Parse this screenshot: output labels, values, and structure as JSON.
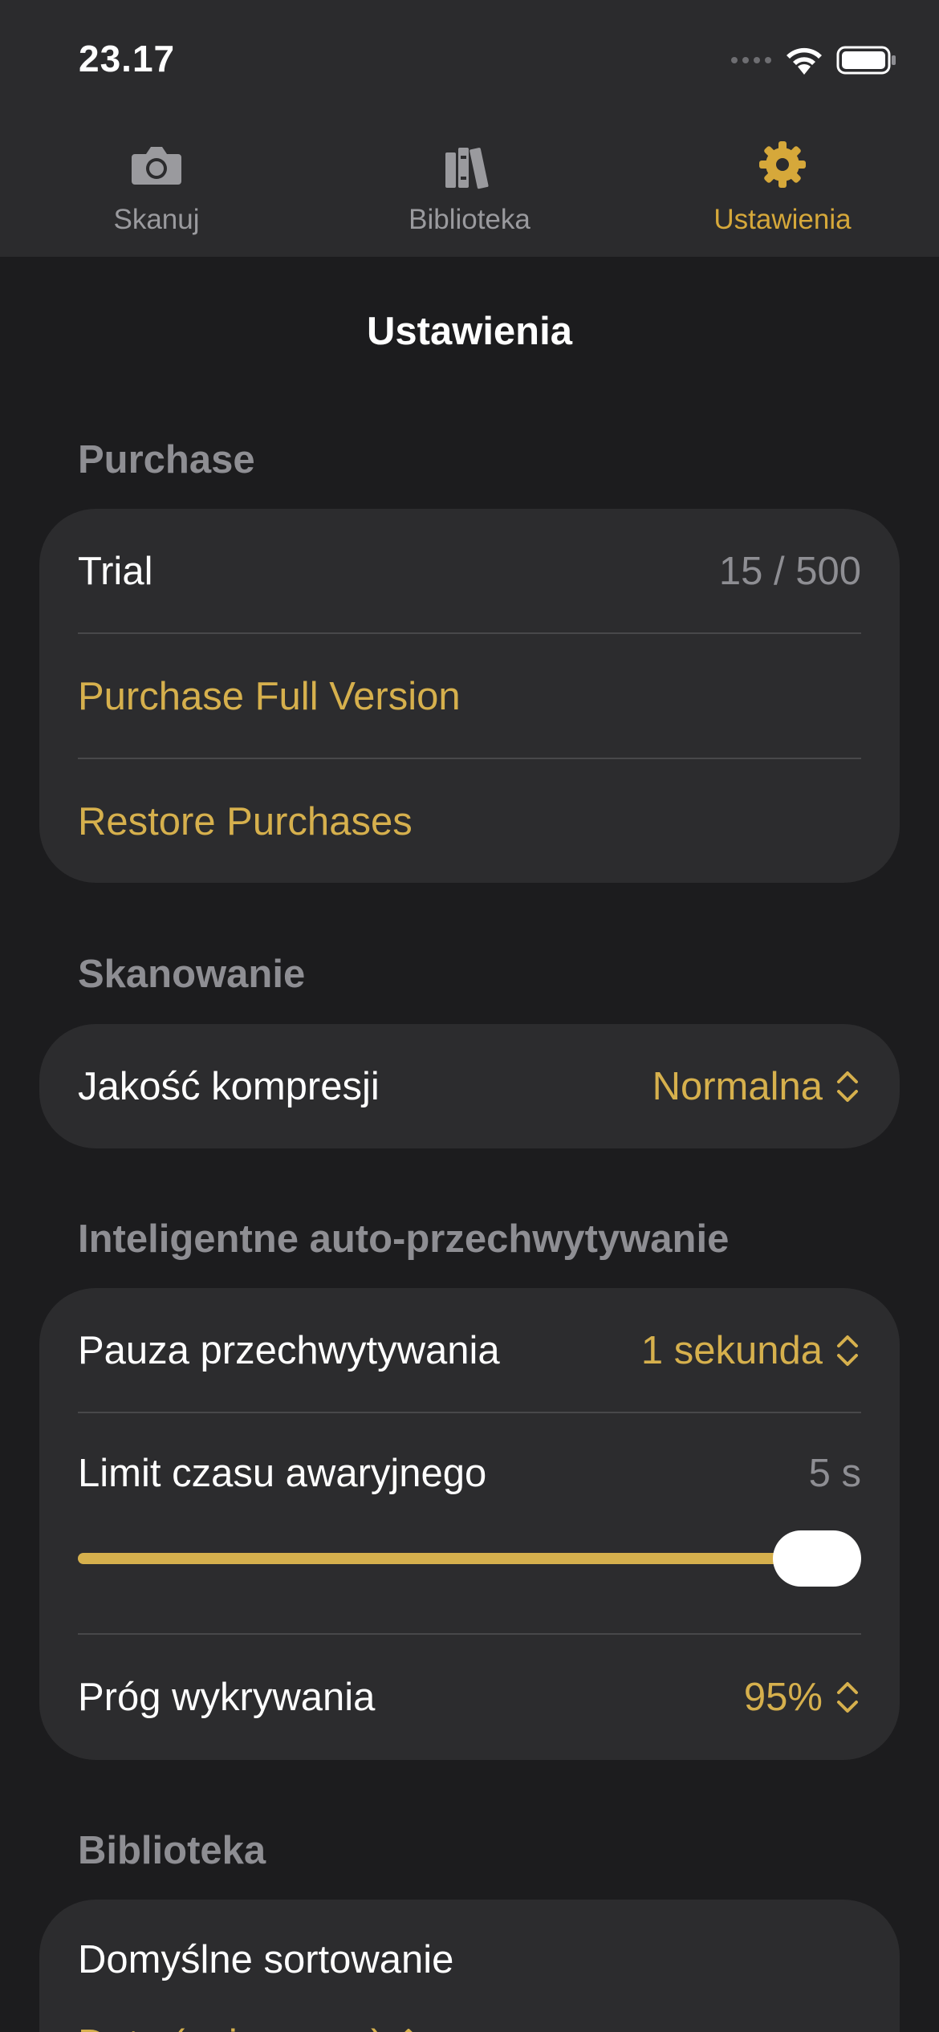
{
  "status_bar": {
    "time": "23.17"
  },
  "tabs": [
    {
      "label": "Skanuj",
      "icon": "camera-icon",
      "active": false
    },
    {
      "label": "Biblioteka",
      "icon": "books-icon",
      "active": false
    },
    {
      "label": "Ustawienia",
      "icon": "gear-icon",
      "active": true
    }
  ],
  "page_title": "Ustawienia",
  "colors": {
    "accent": "#d6b04d",
    "background": "#1c1c1e",
    "card": "#2c2c2e"
  },
  "purchase": {
    "header": "Purchase",
    "trial_label": "Trial",
    "trial_value": "15 / 500",
    "purchase_full": "Purchase Full Version",
    "restore": "Restore Purchases"
  },
  "scanning": {
    "header": "Skanowanie",
    "compression_label": "Jakość kompresji",
    "compression_value": "Normalna"
  },
  "smart_capture": {
    "header": "Inteligentne auto-przechwytywanie",
    "pause_label": "Pauza przechwytywania",
    "pause_value": "1 sekunda",
    "timeout_label": "Limit czasu awaryjnego",
    "timeout_value": "5 s",
    "timeout_slider_fraction": 1.0,
    "threshold_label": "Próg wykrywania",
    "threshold_value": "95%"
  },
  "library": {
    "header": "Biblioteka",
    "sort_label": "Domyślne sortowanie",
    "sort_value": "Data (najnowsze)"
  }
}
